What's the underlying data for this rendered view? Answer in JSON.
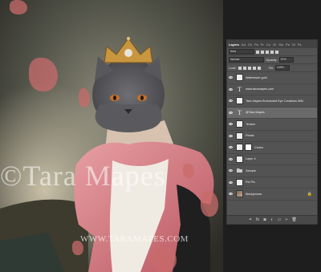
{
  "watermark": {
    "main": "©Tara Mapes",
    "url": "WWW.TARAMAPES.COM"
  },
  "layers_panel": {
    "tabs": [
      "Layers",
      "Ad",
      "Ch",
      "Pa",
      "Pr",
      "Co",
      "Gr",
      "Sw",
      "Pa",
      "Gl",
      "Ps"
    ],
    "active_tab": "Layers",
    "filter_kind": "Kind",
    "blend_mode": "Normal",
    "opacity_label": "Opacity:",
    "opacity_value": "97%",
    "lock_label": "Lock:",
    "fill_label": "Fill:",
    "fill_value": "100%",
    "layers": [
      {
        "name": "Watermark gold",
        "type": "image",
        "selected": false,
        "italic": false
      },
      {
        "name": "www.taramapes.com",
        "type": "text",
        "selected": false,
        "italic": false
      },
      {
        "name": "Tara Mapes Enchanted Eye Creations WM",
        "type": "image",
        "selected": false,
        "italic": false
      },
      {
        "name": "@Tara Mapes",
        "type": "text",
        "selected": true,
        "italic": false
      },
      {
        "name": "Texture",
        "type": "image",
        "selected": false,
        "italic": false
      },
      {
        "name": "Petals",
        "type": "image",
        "selected": false,
        "italic": false
      },
      {
        "name": "Crown",
        "type": "masked",
        "selected": false,
        "italic": false
      },
      {
        "name": "Layer 4",
        "type": "image",
        "selected": false,
        "italic": false
      },
      {
        "name": "Sample",
        "type": "folder",
        "selected": false,
        "italic": false
      },
      {
        "name": "Pet Pic",
        "type": "image",
        "selected": false,
        "italic": false
      },
      {
        "name": "Background",
        "type": "background",
        "selected": false,
        "italic": true
      }
    ]
  },
  "colors": {
    "panel_bg": "#535353",
    "selected_layer": "#6a6a6a",
    "dress_pink": "#d9848a",
    "crown_gold": "#c8963f"
  }
}
